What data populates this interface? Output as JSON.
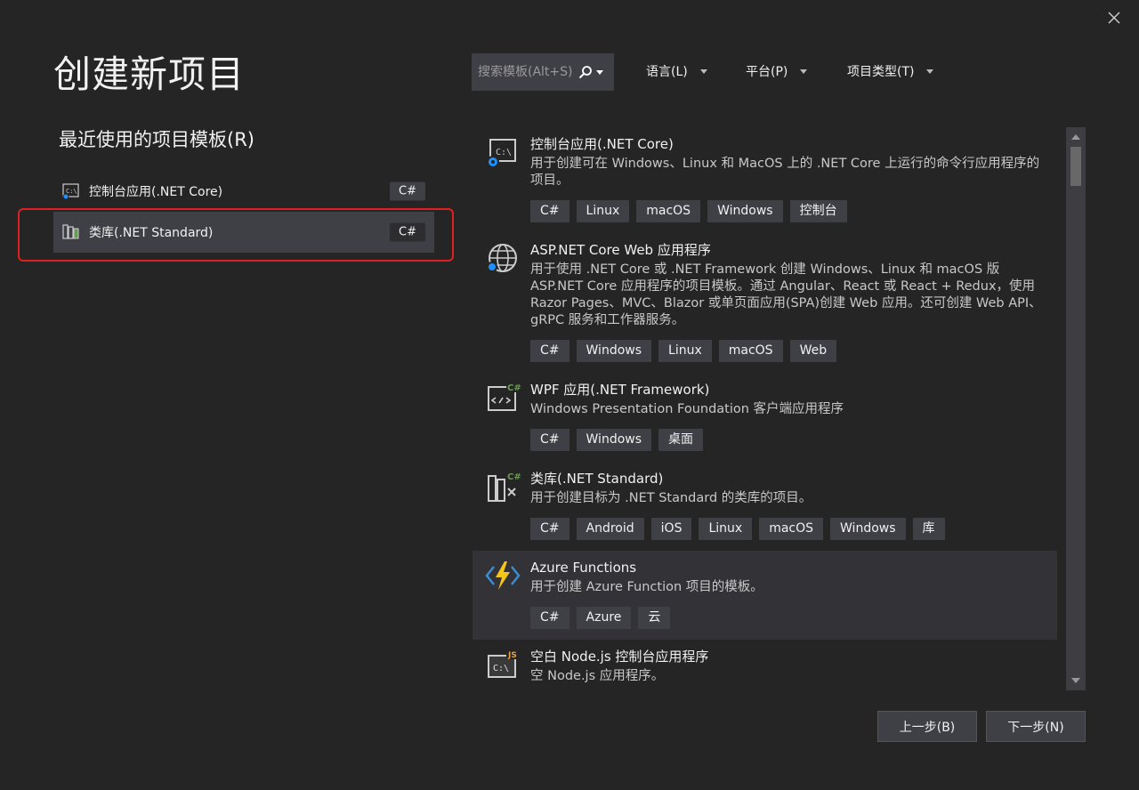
{
  "page_title": "创建新项目",
  "close_label": "",
  "recent": {
    "heading": "最近使用的项目模板(R)",
    "items": [
      {
        "label": "控制台应用(.NET Core)",
        "lang": "C#",
        "icon": "console-app-icon"
      },
      {
        "label": "类库(.NET Standard)",
        "lang": "C#",
        "icon": "class-library-icon"
      }
    ]
  },
  "search": {
    "placeholder": "搜索模板(Alt+S)"
  },
  "filters": {
    "language": "语言(L)",
    "platform": "平台(P)",
    "project_type": "项目类型(T)"
  },
  "templates": [
    {
      "name": "控制台应用(.NET Core)",
      "desc": "用于创建可在 Windows、Linux 和 MacOS 上的 .NET Core 上运行的命令行应用程序的项目。",
      "tags": [
        "C#",
        "Linux",
        "macOS",
        "Windows",
        "控制台"
      ],
      "icon": "console-app-icon"
    },
    {
      "name": "ASP.NET Core Web 应用程序",
      "desc": "用于使用 .NET Core 或 .NET Framework 创建 Windows、Linux 和 macOS 版 ASP.NET Core 应用程序的项目模板。通过 Angular、React 或 React + Redux，使用 Razor Pages、MVC、Blazor 或单页面应用(SPA)创建 Web 应用。还可创建 Web API、gRPC 服务和工作器服务。",
      "tags": [
        "C#",
        "Windows",
        "Linux",
        "macOS",
        "Web"
      ],
      "icon": "globe-icon"
    },
    {
      "name": "WPF 应用(.NET Framework)",
      "desc": "Windows Presentation Foundation 客户端应用程序",
      "tags": [
        "C#",
        "Windows",
        "桌面"
      ],
      "icon": "wpf-app-icon"
    },
    {
      "name": "类库(.NET Standard)",
      "desc": "用于创建目标为 .NET Standard 的类库的项目。",
      "tags": [
        "C#",
        "Android",
        "iOS",
        "Linux",
        "macOS",
        "Windows",
        "库"
      ],
      "icon": "class-library-icon"
    },
    {
      "name": "Azure Functions",
      "desc": "用于创建 Azure Function 项目的模板。",
      "tags": [
        "C#",
        "Azure",
        "云"
      ],
      "icon": "lightning-icon"
    },
    {
      "name": "空白 Node.js 控制台应用程序",
      "desc": "空 Node.js 应用程序。",
      "tags": [],
      "icon": "nodejs-console-icon"
    }
  ],
  "buttons": {
    "back": "上一步(B)",
    "next": "下一步(N)"
  },
  "colors": {
    "background": "#252526",
    "selected_row": "#3f3f46",
    "tag_bg": "#3f3f46",
    "highlight": "#e02020",
    "accent_blue": "#1e90ff",
    "azure_yellow": "#f5c518"
  }
}
